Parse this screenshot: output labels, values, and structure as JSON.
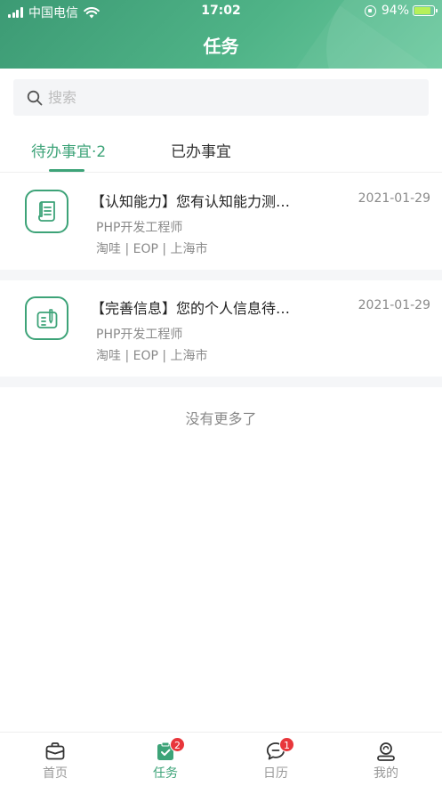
{
  "status_bar": {
    "carrier": "中国电信",
    "time": "17:02",
    "battery": "94%"
  },
  "header": {
    "title": "任务"
  },
  "search": {
    "placeholder": "搜索"
  },
  "tabs": [
    {
      "label": "待办事宜·2",
      "active": true
    },
    {
      "label": "已办事宜",
      "active": false
    }
  ],
  "tasks": [
    {
      "title": "【认知能力】您有认知能力测…",
      "date": "2021-01-29",
      "position": "PHP开发工程师",
      "location": "淘哇 | EOP | 上海市",
      "icon": "document-icon"
    },
    {
      "title": "【完善信息】您的个人信息待…",
      "date": "2021-01-29",
      "position": "PHP开发工程师",
      "location": "淘哇 | EOP | 上海市",
      "icon": "edit-info-icon"
    }
  ],
  "no_more": "没有更多了",
  "tabbar": [
    {
      "label": "首页",
      "icon": "briefcase-icon",
      "badge": ""
    },
    {
      "label": "任务",
      "icon": "task-icon",
      "badge": "2"
    },
    {
      "label": "日历",
      "icon": "chat-icon",
      "badge": "1"
    },
    {
      "label": "我的",
      "icon": "profile-icon",
      "badge": ""
    }
  ],
  "colors": {
    "accent": "#3da378",
    "header_start": "#3c9a74",
    "header_end": "#6ccaa0",
    "badge": "#e8363b"
  }
}
